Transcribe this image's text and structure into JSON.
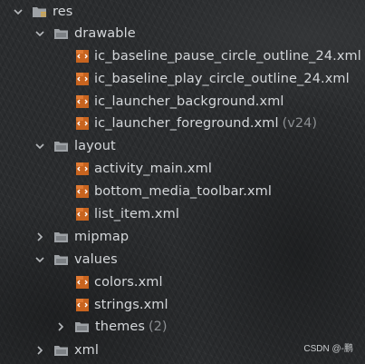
{
  "tree": {
    "root": {
      "label": "res"
    },
    "drawable": {
      "label": "drawable",
      "files": [
        {
          "label": "ic_baseline_pause_circle_outline_24.xml"
        },
        {
          "label": "ic_baseline_play_circle_outline_24.xml"
        },
        {
          "label": "ic_launcher_background.xml"
        },
        {
          "label": "ic_launcher_foreground.xml",
          "hint": "(v24)"
        }
      ]
    },
    "layout": {
      "label": "layout",
      "files": [
        {
          "label": "activity_main.xml"
        },
        {
          "label": "bottom_media_toolbar.xml"
        },
        {
          "label": "list_item.xml"
        }
      ]
    },
    "mipmap": {
      "label": "mipmap"
    },
    "values": {
      "label": "values",
      "files": [
        {
          "label": "colors.xml"
        },
        {
          "label": "strings.xml"
        }
      ],
      "themes": {
        "label": "themes",
        "count": "(2)"
      }
    },
    "xml": {
      "label": "xml"
    }
  },
  "watermark": "CSDN @-鹏",
  "colors": {
    "text": "#d4d7da",
    "hint": "#8c8f92",
    "xml_icon": "#c8641f",
    "folder": "#9ea2a6"
  },
  "icons": {
    "expanded": "chevron-down-icon",
    "collapsed": "chevron-right-icon",
    "folder": "folder-icon",
    "res_folder": "resource-folder-icon",
    "xml_file": "xml-file-icon"
  }
}
